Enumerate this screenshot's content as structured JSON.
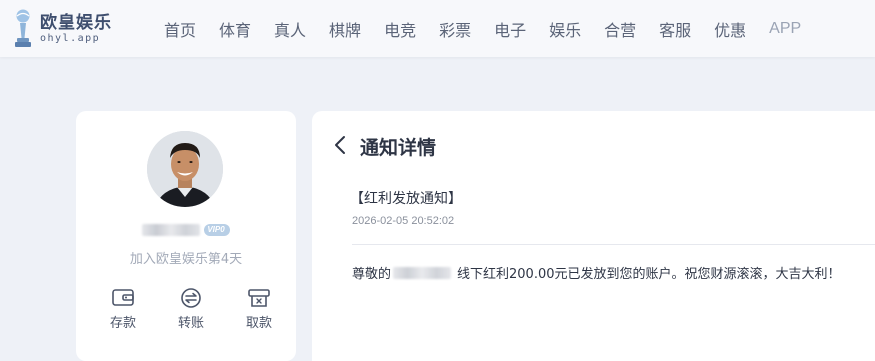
{
  "brand": {
    "name": "欧皇娱乐",
    "domain": "ohyl.app"
  },
  "nav": {
    "items": [
      "首页",
      "体育",
      "真人",
      "棋牌",
      "电竞",
      "彩票",
      "电子",
      "娱乐",
      "合营",
      "客服",
      "优惠"
    ],
    "app_label": "APP"
  },
  "profile": {
    "vip_label": "VIP0",
    "join_text": "加入欧皇娱乐第4天",
    "actions": [
      {
        "label": "存款",
        "icon": "wallet-icon"
      },
      {
        "label": "转账",
        "icon": "transfer-icon"
      },
      {
        "label": "取款",
        "icon": "withdraw-icon"
      }
    ]
  },
  "notification": {
    "page_title": "通知详情",
    "title": "【红利发放通知】",
    "timestamp": "2026-02-05 20:52:02",
    "body_prefix": "尊敬的",
    "body_suffix": "线下红利200.00元已发放到您的账户。祝您财源滚滚，大吉大利！"
  },
  "colors": {
    "background": "#eef1f7",
    "card": "#ffffff",
    "brand_text": "#3e4e6e",
    "nav_text": "#5b6478",
    "muted": "#a3aab8",
    "vip_badge": "#b8cfe6"
  }
}
